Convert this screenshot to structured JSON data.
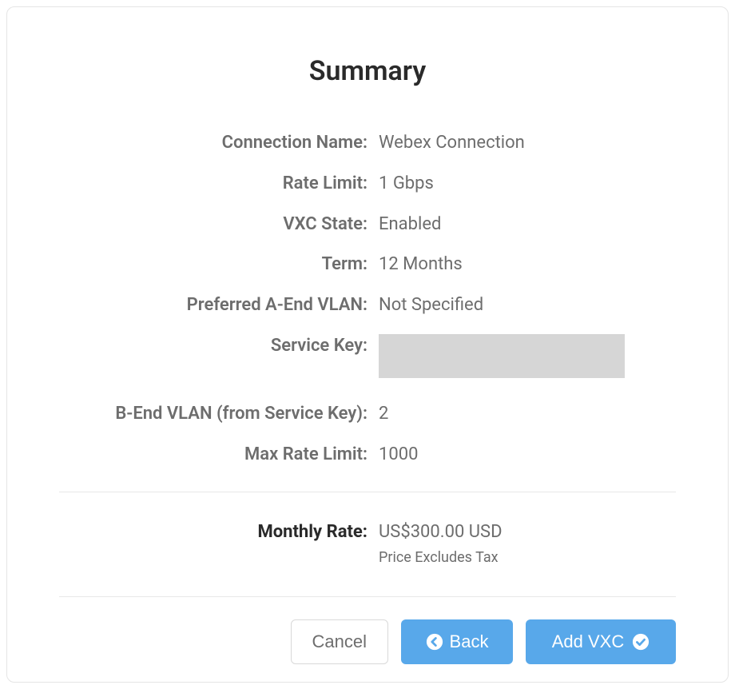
{
  "title": "Summary",
  "fields": {
    "connection_name": {
      "label": "Connection Name:",
      "value": "Webex Connection"
    },
    "rate_limit": {
      "label": "Rate Limit:",
      "value": "1 Gbps"
    },
    "vxc_state": {
      "label": "VXC State:",
      "value": "Enabled"
    },
    "term": {
      "label": "Term:",
      "value": "12 Months"
    },
    "preferred_a_end_vlan": {
      "label": "Preferred A-End VLAN:",
      "value": "Not Specified"
    },
    "service_key": {
      "label": "Service Key:",
      "value": ""
    },
    "b_end_vlan": {
      "label": "B-End VLAN (from Service Key):",
      "value": "2"
    },
    "max_rate_limit": {
      "label": "Max Rate Limit:",
      "value": "1000"
    }
  },
  "price": {
    "label": "Monthly Rate:",
    "value": "US$300.00 USD",
    "note": "Price Excludes Tax"
  },
  "buttons": {
    "cancel": "Cancel",
    "back": "Back",
    "add": "Add VXC"
  }
}
